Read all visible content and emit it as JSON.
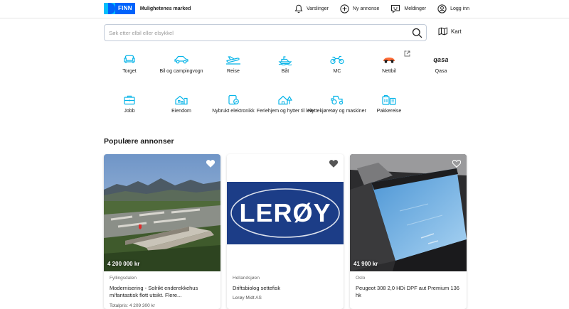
{
  "header": {
    "logo_text": "FINN",
    "tagline": "Mulighetenes marked",
    "nav": [
      {
        "label": "Varslinger",
        "icon": "bell-icon"
      },
      {
        "label": "Ny annonse",
        "icon": "plus-circle-icon"
      },
      {
        "label": "Meldinger",
        "icon": "chat-icon"
      },
      {
        "label": "Logg inn",
        "icon": "user-icon"
      }
    ]
  },
  "search": {
    "placeholder": "Søk etter elbil eller elsykkel",
    "map_label": "Kart"
  },
  "categories": [
    {
      "label": "Torget",
      "icon": "sofa-icon"
    },
    {
      "label": "Bil og campingvogn",
      "icon": "car-icon"
    },
    {
      "label": "Reise",
      "icon": "plane-icon"
    },
    {
      "label": "Båt",
      "icon": "boat-icon"
    },
    {
      "label": "MC",
      "icon": "motorcycle-icon"
    },
    {
      "label": "Nettbil",
      "icon": "nettbil-logo-icon"
    },
    {
      "label": "Qasa",
      "logo_text": "qasa"
    },
    {
      "label": "Jobb",
      "icon": "briefcase-icon"
    },
    {
      "label": "Eiendom",
      "icon": "house-icon"
    },
    {
      "label": "Nybrukt elektronikk",
      "icon": "device-icon"
    },
    {
      "label": "Feriehjem og hytter til leie",
      "icon": "cabin-icon"
    },
    {
      "label": "Nyttekjøretøy og maskiner",
      "icon": "tractor-icon"
    },
    {
      "label": "Pakkereise",
      "icon": "luggage-icon"
    }
  ],
  "section_title": "Populære annonser",
  "cards": [
    {
      "price": "4 200 000 kr",
      "location": "Fyllingsdalen",
      "title": "Modernisering - Solrikt enderekkehus m/fantastisk flott utsikt. Flere...",
      "sub": "Totalpris: 4 209 300 kr"
    },
    {
      "logo_text": "LERØY",
      "location": "Hellandsjøen",
      "title": "Driftsbiolog settefisk",
      "sub": "Lerøy Midt AS"
    },
    {
      "price": "41 900 kr",
      "location": "Oslo",
      "title": "Peugeot 308 2,0 HDi DPF aut Premium 136 hk"
    }
  ],
  "colors": {
    "brand_blue": "#0063fb",
    "brand_light_blue": "#06befb",
    "icon_cyan": "#06b4e8",
    "leroy_blue": "#1c3d87"
  }
}
